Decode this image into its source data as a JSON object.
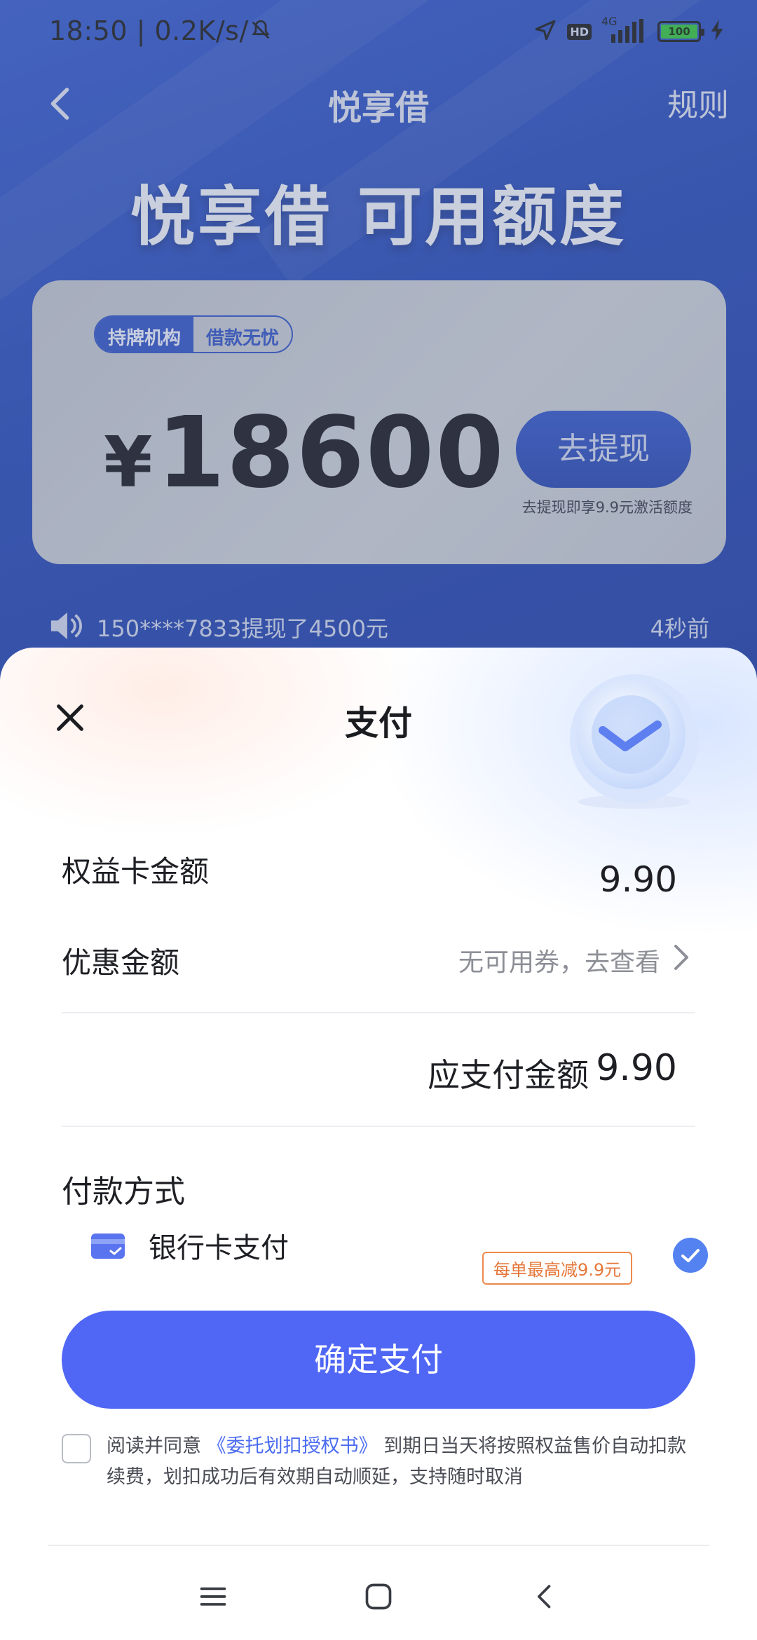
{
  "status_bar": {
    "time": "18:50",
    "speed": "0.2K/s",
    "network": "4G",
    "hd": "HD",
    "battery": "100"
  },
  "nav": {
    "title": "悦享借",
    "rules": "规则"
  },
  "hero": {
    "title": "悦享借 可用额度"
  },
  "card": {
    "tag_licensed": "持牌机构",
    "tag_no_worry": "借款无忧",
    "currency": "¥",
    "amount": "18600",
    "withdraw_button": "去提现",
    "withdraw_note": "去提现即享9.9元激活额度"
  },
  "ticker": {
    "text": "150****7833提现了4500元",
    "time": "4秒前"
  },
  "payment_sheet": {
    "title": "支付",
    "card_fee_label": "权益卡金额",
    "card_fee_value": "9.90",
    "discount_label": "优惠金额",
    "discount_value": "无可用券，去查看",
    "due_label": "应支付金额",
    "due_value": "9.90",
    "method_title": "付款方式",
    "bank_label": "银行卡支付",
    "bank_promo": "每单最高减9.9元",
    "confirm_button": "确定支付",
    "agreement_prefix": "阅读并同意",
    "agreement_link": "《委托划扣授权书》",
    "agreement_suffix": "到期日当天将按照权益售价自动扣款续费，划扣成功后有效期自动顺延，支持随时取消"
  },
  "colors": {
    "primary_button": "#5067f5",
    "link": "#4b6cf0",
    "promo_orange": "#e5773a",
    "check_blue": "#5482f0",
    "background_blue": "#2246b7"
  },
  "icons": [
    "location-icon",
    "signal-icon",
    "battery-icon",
    "charging-icon",
    "mute-icon",
    "back-icon",
    "speaker-icon",
    "close-icon",
    "chevron-right-icon",
    "bank-card-icon",
    "check-icon",
    "menu-icon",
    "home-icon"
  ]
}
